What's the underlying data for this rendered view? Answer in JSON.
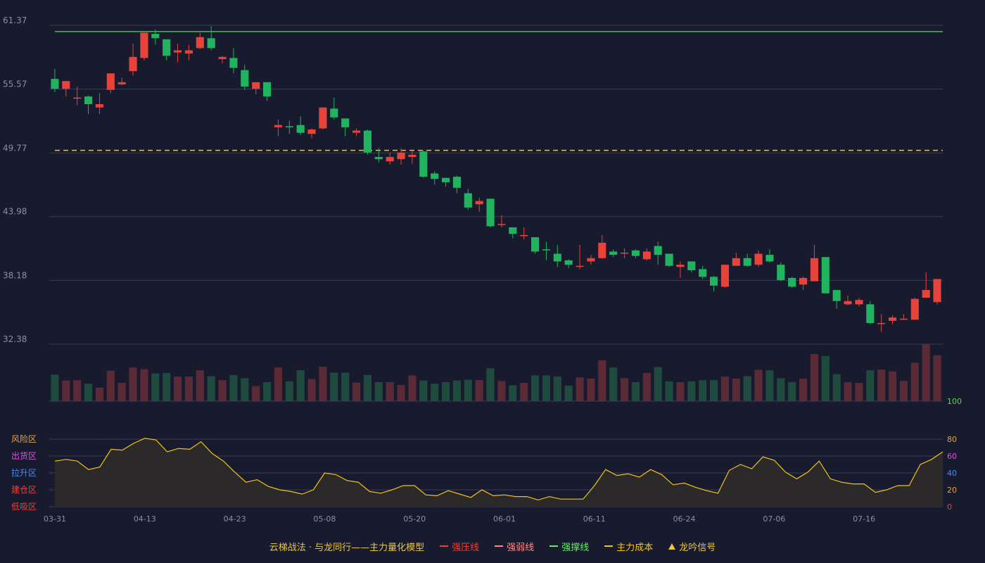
{
  "colors": {
    "background": "#181a2e",
    "up": "#e8433a",
    "down": "#21b360",
    "up_volume": "#5a2a36",
    "down_volume": "#1f4a3e",
    "grid": "#3a3d52",
    "axis_text": "#8d90a6",
    "resistance": "#5cd65c",
    "cost": "#f2c318",
    "indicator_line": "#f2c318",
    "indicator_fill": "#2e2b2a"
  },
  "legend": {
    "title": "云梯战法 · 与龙同行——主力量化模型",
    "items": [
      {
        "label": "强压线",
        "color": "#e8433a",
        "style": "solid"
      },
      {
        "label": "强弱线",
        "color": "#ff8888",
        "style": "dashed"
      },
      {
        "label": "强撑线",
        "color": "#66ee66",
        "style": "solid"
      },
      {
        "label": "主力成本",
        "color": "#f2c318",
        "style": "dashed"
      },
      {
        "label": "龙吟信号",
        "color": "#e8c64a",
        "style": "triangle"
      }
    ]
  },
  "chart_data": {
    "type": "candlestick",
    "price_axis": {
      "ticks": [
        "61.37",
        "55.57",
        "49.77",
        "43.98",
        "38.18",
        "32.38"
      ],
      "range": [
        32.38,
        61.37
      ]
    },
    "x_axis": {
      "ticks": [
        {
          "index": 0,
          "label": "03-31"
        },
        {
          "index": 8,
          "label": "04-13"
        },
        {
          "index": 16,
          "label": "04-23"
        },
        {
          "index": 24,
          "label": "05-08"
        },
        {
          "index": 32,
          "label": "05-20"
        },
        {
          "index": 40,
          "label": "06-01"
        },
        {
          "index": 48,
          "label": "06-11"
        },
        {
          "index": 56,
          "label": "06-24"
        },
        {
          "index": 64,
          "label": "07-06"
        },
        {
          "index": 72,
          "label": "07-16"
        }
      ]
    },
    "resistance_level": 60.8,
    "main_cost_level": 50.0,
    "candles": [
      [
        56.5,
        55.6,
        57.4,
        55.3
      ],
      [
        55.6,
        56.3,
        56.3,
        54.9
      ],
      [
        54.8,
        54.8,
        55.8,
        54.1
      ],
      [
        54.9,
        54.2,
        55.0,
        53.3
      ],
      [
        53.9,
        54.2,
        55.2,
        53.3
      ],
      [
        55.5,
        57.0,
        57.0,
        55.2
      ],
      [
        56.0,
        56.2,
        56.6,
        55.9
      ],
      [
        57.2,
        58.5,
        59.7,
        56.8
      ],
      [
        58.4,
        60.7,
        60.7,
        58.2
      ],
      [
        60.6,
        60.2,
        61.0,
        59.6
      ],
      [
        60.1,
        58.6,
        60.1,
        58.2
      ],
      [
        58.9,
        59.1,
        59.7,
        58.0
      ],
      [
        58.8,
        59.1,
        59.6,
        58.2
      ],
      [
        59.3,
        60.3,
        60.7,
        59.2
      ],
      [
        60.2,
        59.3,
        61.3,
        59.1
      ],
      [
        58.3,
        58.5,
        58.6,
        57.9
      ],
      [
        58.4,
        57.5,
        59.3,
        57.0
      ],
      [
        57.3,
        55.8,
        57.8,
        55.5
      ],
      [
        55.6,
        56.2,
        56.2,
        55.1
      ],
      [
        56.2,
        54.9,
        56.2,
        54.5
      ],
      [
        52.1,
        52.3,
        52.8,
        51.3
      ],
      [
        52.2,
        52.1,
        52.7,
        51.5
      ],
      [
        52.3,
        51.6,
        53.1,
        51.4
      ],
      [
        51.5,
        51.9,
        52.0,
        51.1
      ],
      [
        52.0,
        53.9,
        53.9,
        51.9
      ],
      [
        53.8,
        53.0,
        54.8,
        52.8
      ],
      [
        52.9,
        52.1,
        52.9,
        51.3
      ],
      [
        51.6,
        51.8,
        52.0,
        51.3
      ],
      [
        51.8,
        49.8,
        51.9,
        49.6
      ],
      [
        49.4,
        49.2,
        50.2,
        48.9
      ],
      [
        49.0,
        49.4,
        49.8,
        48.7
      ],
      [
        49.2,
        49.8,
        50.2,
        48.7
      ],
      [
        49.4,
        49.6,
        50.0,
        48.8
      ],
      [
        49.9,
        47.6,
        50.0,
        47.5
      ],
      [
        47.9,
        47.4,
        48.1,
        46.9
      ],
      [
        47.5,
        47.1,
        47.5,
        46.7
      ],
      [
        47.6,
        46.6,
        47.7,
        46.1
      ],
      [
        46.1,
        44.8,
        46.5,
        44.6
      ],
      [
        45.1,
        45.4,
        45.7,
        44.4
      ],
      [
        45.6,
        43.1,
        45.6,
        43.0
      ],
      [
        43.2,
        43.3,
        44.1,
        43.0
      ],
      [
        43.0,
        42.4,
        43.0,
        42.0
      ],
      [
        42.2,
        42.3,
        43.0,
        41.9
      ],
      [
        42.1,
        40.8,
        42.1,
        40.6
      ],
      [
        41.0,
        40.9,
        41.7,
        40.0
      ],
      [
        40.6,
        39.9,
        41.4,
        39.4
      ],
      [
        40.0,
        39.6,
        40.1,
        39.3
      ],
      [
        39.5,
        39.5,
        41.4,
        39.2
      ],
      [
        39.9,
        40.2,
        40.5,
        39.6
      ],
      [
        40.2,
        41.6,
        42.3,
        40.1
      ],
      [
        40.8,
        40.5,
        41.0,
        40.3
      ],
      [
        40.7,
        40.7,
        41.1,
        40.2
      ],
      [
        40.9,
        40.4,
        41.0,
        40.2
      ],
      [
        40.1,
        40.8,
        41.1,
        40.0
      ],
      [
        41.3,
        40.5,
        41.7,
        39.6
      ],
      [
        40.6,
        39.5,
        40.6,
        39.4
      ],
      [
        39.4,
        39.6,
        39.9,
        38.4
      ],
      [
        39.9,
        39.1,
        39.9,
        38.9
      ],
      [
        39.2,
        38.5,
        39.5,
        38.3
      ],
      [
        38.5,
        37.7,
        38.6,
        37.2
      ],
      [
        37.6,
        39.6,
        39.6,
        37.5
      ],
      [
        39.5,
        40.2,
        40.7,
        39.5
      ],
      [
        40.2,
        39.5,
        40.6,
        39.4
      ],
      [
        39.6,
        40.6,
        40.9,
        39.4
      ],
      [
        40.5,
        39.9,
        41.0,
        39.8
      ],
      [
        39.6,
        38.2,
        39.8,
        38.1
      ],
      [
        38.4,
        37.6,
        38.5,
        37.5
      ],
      [
        37.8,
        38.4,
        38.5,
        37.3
      ],
      [
        38.1,
        40.2,
        41.4,
        38.1
      ],
      [
        40.3,
        37.0,
        40.3,
        37.0
      ],
      [
        37.3,
        36.3,
        37.3,
        35.6
      ],
      [
        36.0,
        36.3,
        36.8,
        35.9
      ],
      [
        36.0,
        36.4,
        36.6,
        35.8
      ],
      [
        36.0,
        34.3,
        36.3,
        34.2
      ],
      [
        34.3,
        34.3,
        35.1,
        33.5
      ],
      [
        34.5,
        34.8,
        35.0,
        34.2
      ],
      [
        34.6,
        34.7,
        35.1,
        34.6
      ],
      [
        34.6,
        36.5,
        36.6,
        34.6
      ],
      [
        36.6,
        37.3,
        38.9,
        36.6
      ],
      [
        36.2,
        38.3,
        38.3,
        36.0
      ]
    ],
    "volume": [
      67,
      52,
      53,
      44,
      34,
      77,
      46,
      85,
      81,
      70,
      71,
      62,
      62,
      78,
      63,
      53,
      66,
      58,
      38,
      48,
      85,
      50,
      78,
      56,
      87,
      72,
      72,
      47,
      66,
      48,
      48,
      41,
      65,
      52,
      44,
      48,
      52,
      54,
      53,
      83,
      51,
      40,
      46,
      65,
      65,
      62,
      39,
      60,
      57,
      103,
      85,
      58,
      48,
      71,
      86,
      50,
      48,
      50,
      53,
      53,
      62,
      57,
      63,
      79,
      78,
      58,
      48,
      57,
      119,
      114,
      68,
      48,
      46,
      78,
      80,
      75,
      51,
      97,
      144,
      116
    ],
    "indicator": {
      "zones": [
        {
          "label": "风险区",
          "color": "#e8a33a"
        },
        {
          "label": "出货区",
          "color": "#e04fe0"
        },
        {
          "label": "拉升区",
          "color": "#4a8ae8"
        },
        {
          "label": "建仓区",
          "color": "#e8433a"
        },
        {
          "label": "低吸区",
          "color": "#e8433a"
        }
      ],
      "right_ticks": [
        {
          "label": "100",
          "color": "#5cd65c"
        },
        {
          "label": "80",
          "color": "#e8a33a"
        },
        {
          "label": "60",
          "color": "#e04fe0"
        },
        {
          "label": "40",
          "color": "#4a8ae8"
        },
        {
          "label": "20",
          "color": "#e8a33a"
        },
        {
          "label": "0",
          "color": "#e8433a"
        }
      ],
      "range": [
        0,
        100
      ],
      "values": [
        54,
        56,
        54,
        44,
        47,
        68,
        67,
        75,
        81,
        79,
        65,
        69,
        68,
        77,
        63,
        54,
        41,
        29,
        32,
        24,
        20,
        18,
        15,
        20,
        40,
        38,
        31,
        29,
        18,
        16,
        20,
        25,
        25,
        14,
        13,
        19,
        15,
        11,
        20,
        13,
        14,
        12,
        12,
        8,
        12,
        9,
        9,
        9,
        25,
        44,
        37,
        39,
        35,
        44,
        38,
        26,
        28,
        23,
        19,
        16,
        43,
        50,
        45,
        59,
        55,
        41,
        33,
        41,
        54,
        33,
        29,
        27,
        27,
        17,
        20,
        25,
        25,
        50,
        56,
        65
      ]
    }
  }
}
